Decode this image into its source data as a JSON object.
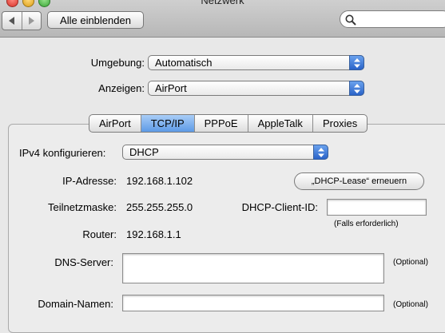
{
  "window": {
    "title": "Netzwerk"
  },
  "toolbar": {
    "show_all_label": "Alle einblenden",
    "back_icon": "triangle-left",
    "forward_icon": "triangle-right",
    "search_icon": "magnifier",
    "search_value": ""
  },
  "location": {
    "label": "Umgebung:",
    "value": "Automatisch"
  },
  "show": {
    "label": "Anzeigen:",
    "value": "AirPort"
  },
  "tabs": [
    {
      "label": "AirPort"
    },
    {
      "label": "TCP/IP",
      "active": true
    },
    {
      "label": "PPPoE"
    },
    {
      "label": "AppleTalk"
    },
    {
      "label": "Proxies"
    }
  ],
  "ipv4": {
    "label": "IPv4 konfigurieren:",
    "value": "DHCP"
  },
  "ip": {
    "label": "IP-Adresse:",
    "value": "192.168.1.102"
  },
  "renew_button": "„DHCP-Lease“ erneuern",
  "subnet": {
    "label": "Teilnetzmaske:",
    "value": "255.255.255.0"
  },
  "client_id": {
    "label": "DHCP-Client-ID:",
    "value": "",
    "hint": "(Falls erforderlich)"
  },
  "router": {
    "label": "Router:",
    "value": "192.168.1.1"
  },
  "dns": {
    "label": "DNS-Server:",
    "value": "",
    "hint": "(Optional)"
  },
  "domains": {
    "label": "Domain-Namen:",
    "value": "",
    "hint": "(Optional)"
  },
  "colors": {
    "accent": "#3d7fe0",
    "close": "#e2463f",
    "minimize": "#e9b22b",
    "zoom": "#4fb54a"
  }
}
